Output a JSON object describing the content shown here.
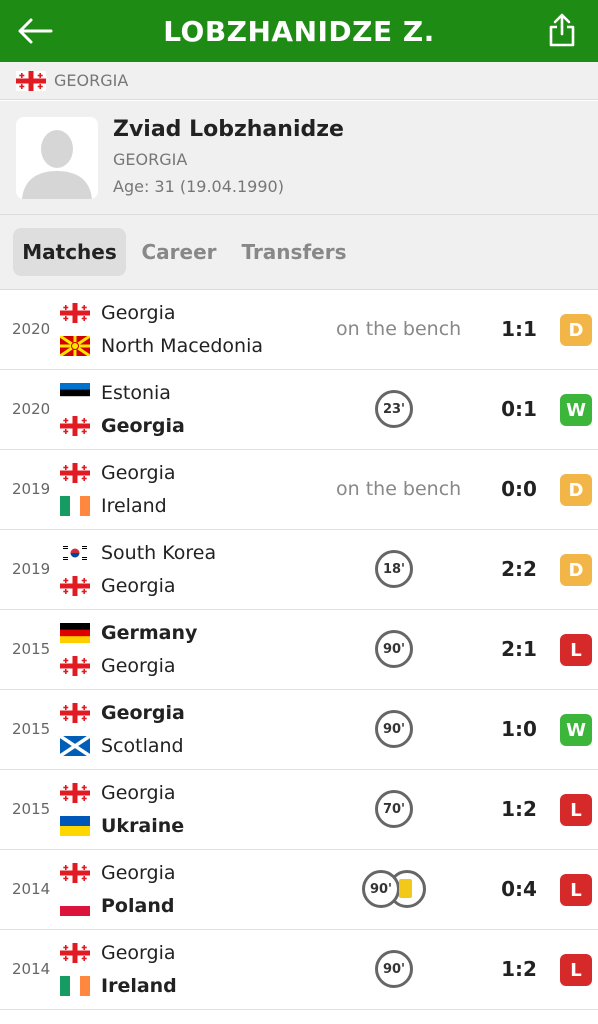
{
  "header": {
    "title": "LOBZHANIDZE Z.",
    "back_icon": "arrow-left-icon",
    "share_icon": "share-icon",
    "color": "#1e8c14"
  },
  "country": {
    "label": "GEORGIA",
    "flag": "georgia"
  },
  "player": {
    "name": "Zviad Lobzhanidze",
    "country": "GEORGIA",
    "age": "Age: 31 (19.04.1990)"
  },
  "tabs": [
    {
      "label": "Matches",
      "active": true
    },
    {
      "label": "Career",
      "active": false
    },
    {
      "label": "Transfers",
      "active": false
    }
  ],
  "matches": [
    {
      "year": "2020",
      "home": {
        "name": "Georgia",
        "flag": "georgia",
        "bold": false
      },
      "away": {
        "name": "North Macedonia",
        "flag": "north-macedonia",
        "bold": false
      },
      "status": "on the bench",
      "minutes": "",
      "yellow_card": false,
      "score": "1:1",
      "result": "D"
    },
    {
      "year": "2020",
      "home": {
        "name": "Estonia",
        "flag": "estonia",
        "bold": false
      },
      "away": {
        "name": "Georgia",
        "flag": "georgia",
        "bold": true
      },
      "status": "",
      "minutes": "23'",
      "yellow_card": false,
      "score": "0:1",
      "result": "W"
    },
    {
      "year": "2019",
      "home": {
        "name": "Georgia",
        "flag": "georgia",
        "bold": false
      },
      "away": {
        "name": "Ireland",
        "flag": "ireland",
        "bold": false
      },
      "status": "on the bench",
      "minutes": "",
      "yellow_card": false,
      "score": "0:0",
      "result": "D"
    },
    {
      "year": "2019",
      "home": {
        "name": "South Korea",
        "flag": "south-korea",
        "bold": false
      },
      "away": {
        "name": "Georgia",
        "flag": "georgia",
        "bold": false
      },
      "status": "",
      "minutes": "18'",
      "yellow_card": false,
      "score": "2:2",
      "result": "D"
    },
    {
      "year": "2015",
      "home": {
        "name": "Germany",
        "flag": "germany",
        "bold": true
      },
      "away": {
        "name": "Georgia",
        "flag": "georgia",
        "bold": false
      },
      "status": "",
      "minutes": "90'",
      "yellow_card": false,
      "score": "2:1",
      "result": "L"
    },
    {
      "year": "2015",
      "home": {
        "name": "Georgia",
        "flag": "georgia",
        "bold": true
      },
      "away": {
        "name": "Scotland",
        "flag": "scotland",
        "bold": false
      },
      "status": "",
      "minutes": "90'",
      "yellow_card": false,
      "score": "1:0",
      "result": "W"
    },
    {
      "year": "2015",
      "home": {
        "name": "Georgia",
        "flag": "georgia",
        "bold": false
      },
      "away": {
        "name": "Ukraine",
        "flag": "ukraine",
        "bold": true
      },
      "status": "",
      "minutes": "70'",
      "yellow_card": false,
      "score": "1:2",
      "result": "L"
    },
    {
      "year": "2014",
      "home": {
        "name": "Georgia",
        "flag": "georgia",
        "bold": false
      },
      "away": {
        "name": "Poland",
        "flag": "poland",
        "bold": true
      },
      "status": "",
      "minutes": "90'",
      "yellow_card": true,
      "score": "0:4",
      "result": "L"
    },
    {
      "year": "2014",
      "home": {
        "name": "Georgia",
        "flag": "georgia",
        "bold": false
      },
      "away": {
        "name": "Ireland",
        "flag": "ireland",
        "bold": true
      },
      "status": "",
      "minutes": "90'",
      "yellow_card": false,
      "score": "1:2",
      "result": "L"
    }
  ]
}
